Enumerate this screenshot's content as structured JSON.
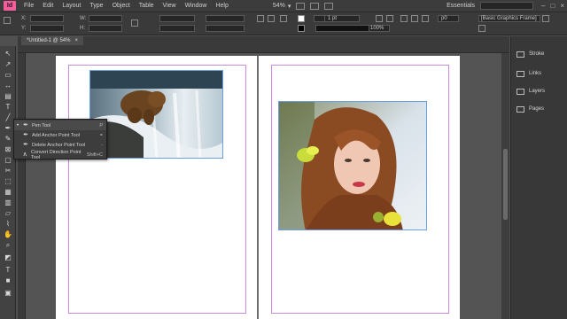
{
  "app": {
    "logo": "Id",
    "zoom": "54%",
    "workspace": "Essentials"
  },
  "menu": [
    "File",
    "Edit",
    "Layout",
    "Type",
    "Object",
    "Table",
    "View",
    "Window",
    "Help"
  ],
  "control": {
    "x_label": "X:",
    "y_label": "Y:",
    "w_label": "W:",
    "h_label": "H:",
    "stroke_weight": "1 pt",
    "percent": "100%",
    "frame_style": "[Basic Graphics Frame]",
    "frame_width_value": "p0"
  },
  "document": {
    "tab_label": "*Untitled-1 @ 54%",
    "tab_close": "×"
  },
  "flyout": {
    "items": [
      {
        "label": "Pen Tool",
        "shortcut": "P",
        "selected": true
      },
      {
        "label": "Add Anchor Point Tool",
        "shortcut": "=",
        "selected": false
      },
      {
        "label": "Delete Anchor Point Tool",
        "shortcut": "-",
        "selected": false
      },
      {
        "label": "Convert Direction Point Tool",
        "shortcut": "Shift+C",
        "selected": false
      }
    ]
  },
  "panels": [
    {
      "label": "Stroke",
      "icon": "stroke-icon"
    },
    {
      "label": "Links",
      "icon": "links-icon"
    },
    {
      "label": "Layers",
      "icon": "layers-icon"
    },
    {
      "label": "Pages",
      "icon": "pages-icon"
    }
  ],
  "colors": {
    "margin_guide": "#c98bdc",
    "frame_selection": "#6aa0e0",
    "logo": "#f25f9a"
  }
}
